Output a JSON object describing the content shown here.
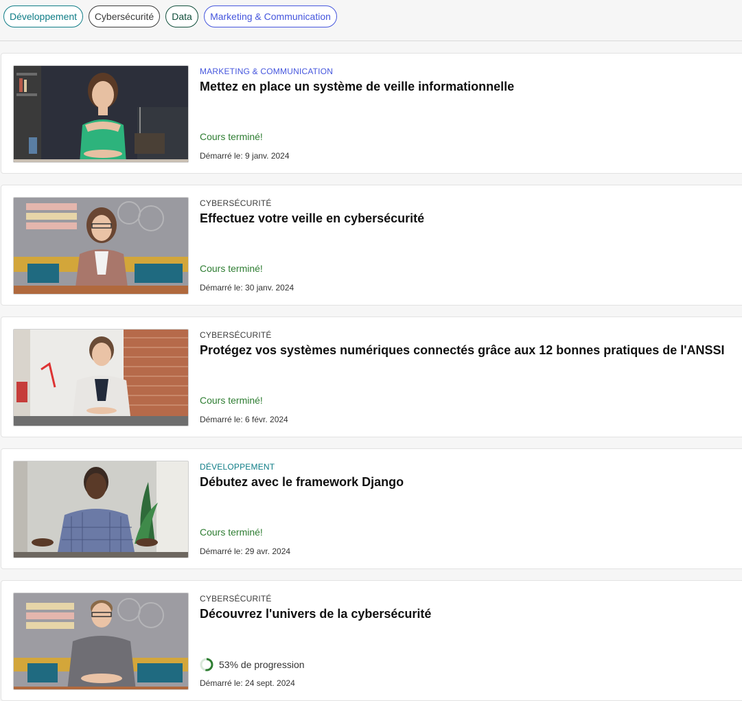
{
  "filters": [
    {
      "label": "Développement"
    },
    {
      "label": "Cybersécurité"
    },
    {
      "label": "Data"
    },
    {
      "label": "Marketing & Communication"
    }
  ],
  "colors": {
    "developpement": "#0e7c86",
    "cybersecurite": "#3b3b3b",
    "data": "#0f4d3a",
    "marketing": "#4455dd",
    "completed": "#2e7d32"
  },
  "courses": [
    {
      "category": "MARKETING & COMMUNICATION",
      "title": "Mettez en place un système de veille informationnelle",
      "status": "Cours terminé!",
      "started": "Démarré le: 9 janv. 2024"
    },
    {
      "category": "CYBERSÉCURITÉ",
      "title": "Effectuez votre veille en cybersécurité",
      "status": "Cours terminé!",
      "started": "Démarré le: 30 janv. 2024"
    },
    {
      "category": "CYBERSÉCURITÉ",
      "title": "Protégez vos systèmes numériques connectés grâce aux 12 bonnes pratiques de l'ANSSI",
      "status": "Cours terminé!",
      "started": "Démarré le: 6 févr. 2024"
    },
    {
      "category": "DÉVELOPPEMENT",
      "title": "Débutez avec le framework Django",
      "status": "Cours terminé!",
      "started": "Démarré le: 29 avr. 2024"
    },
    {
      "category": "CYBERSÉCURITÉ",
      "title": "Découvrez l'univers de la cybersécurité",
      "progress_text": "53% de progression",
      "progress_fraction": 0.53,
      "started": "Démarré le: 24 sept. 2024"
    }
  ]
}
